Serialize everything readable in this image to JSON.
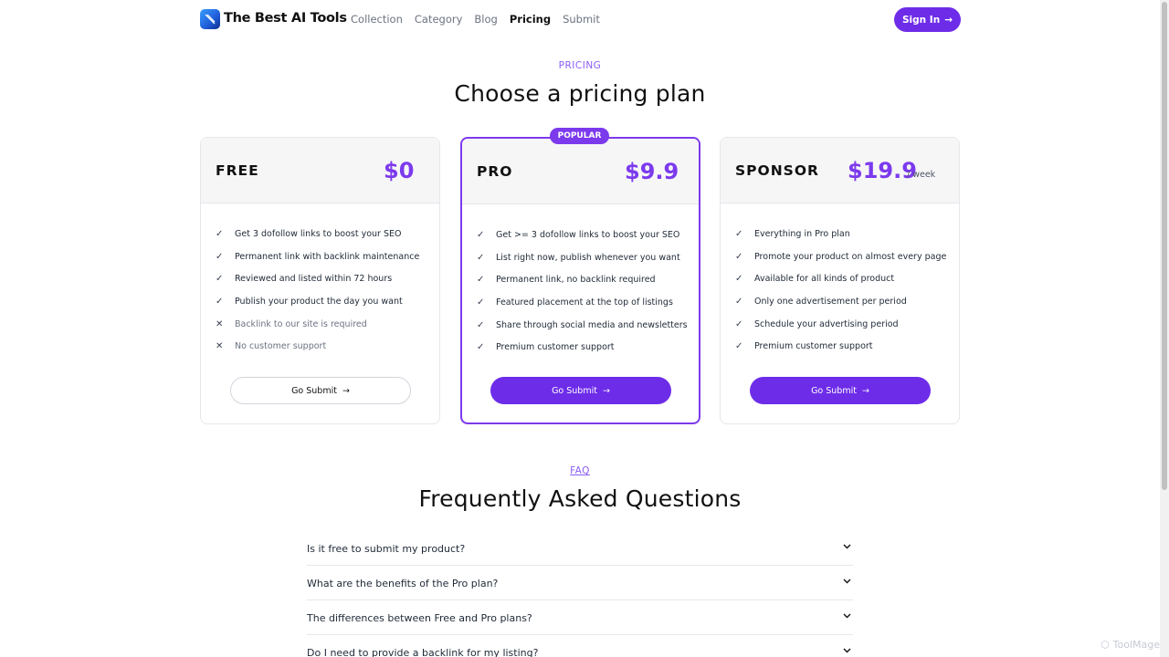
{
  "header": {
    "brand": "The Best AI Tools",
    "nav": [
      "Collection",
      "Category",
      "Blog",
      "Pricing",
      "Submit"
    ],
    "active_nav": "Pricing",
    "signin_label": "Sign In"
  },
  "pricing": {
    "eyebrow": "PRICING",
    "title": "Choose a pricing plan",
    "popular_badge": "POPULAR",
    "plans": [
      {
        "name": "FREE",
        "price": "$0",
        "per": "",
        "features": [
          {
            "text": "Get 3 dofollow links to boost your SEO",
            "included": true
          },
          {
            "text": "Permanent link with backlink maintenance",
            "included": true
          },
          {
            "text": "Reviewed and listed within 72 hours",
            "included": true
          },
          {
            "text": "Publish your product the day you want",
            "included": true
          },
          {
            "text": "Backlink to our site is required",
            "included": false
          },
          {
            "text": "No customer support",
            "included": false
          }
        ],
        "button": "Go Submit"
      },
      {
        "name": "PRO",
        "price": "$9.9",
        "per": "",
        "features": [
          {
            "text": "Get >= 3 dofollow links to boost your SEO",
            "included": true
          },
          {
            "text": "List right now, publish whenever you want",
            "included": true
          },
          {
            "text": "Permanent link, no backlink required",
            "included": true
          },
          {
            "text": "Featured placement at the top of listings",
            "included": true
          },
          {
            "text": "Share through social media and newsletters",
            "included": true
          },
          {
            "text": "Premium customer support",
            "included": true
          }
        ],
        "button": "Go Submit"
      },
      {
        "name": "SPONSOR",
        "price": "$19.9",
        "per": "/ week",
        "features": [
          {
            "text": "Everything in Pro plan",
            "included": true
          },
          {
            "text": "Promote your product on almost every page",
            "included": true
          },
          {
            "text": "Available for all kinds of product",
            "included": true
          },
          {
            "text": "Only one advertisement per period",
            "included": true
          },
          {
            "text": "Schedule your advertising period",
            "included": true
          },
          {
            "text": "Premium customer support",
            "included": true
          }
        ],
        "button": "Go Submit"
      }
    ]
  },
  "faq": {
    "eyebrow": "FAQ",
    "title": "Frequently Asked Questions",
    "questions": [
      "Is it free to submit my product?",
      "What are the benefits of the Pro plan?",
      "The differences between Free and Pro plans?",
      "Do I need to provide a backlink for my listing?"
    ]
  },
  "watermark": "ToolMage",
  "colors": {
    "accent": "#7c3aed",
    "button": "#6d2ce8",
    "eyebrow": "#8b5cf6"
  }
}
